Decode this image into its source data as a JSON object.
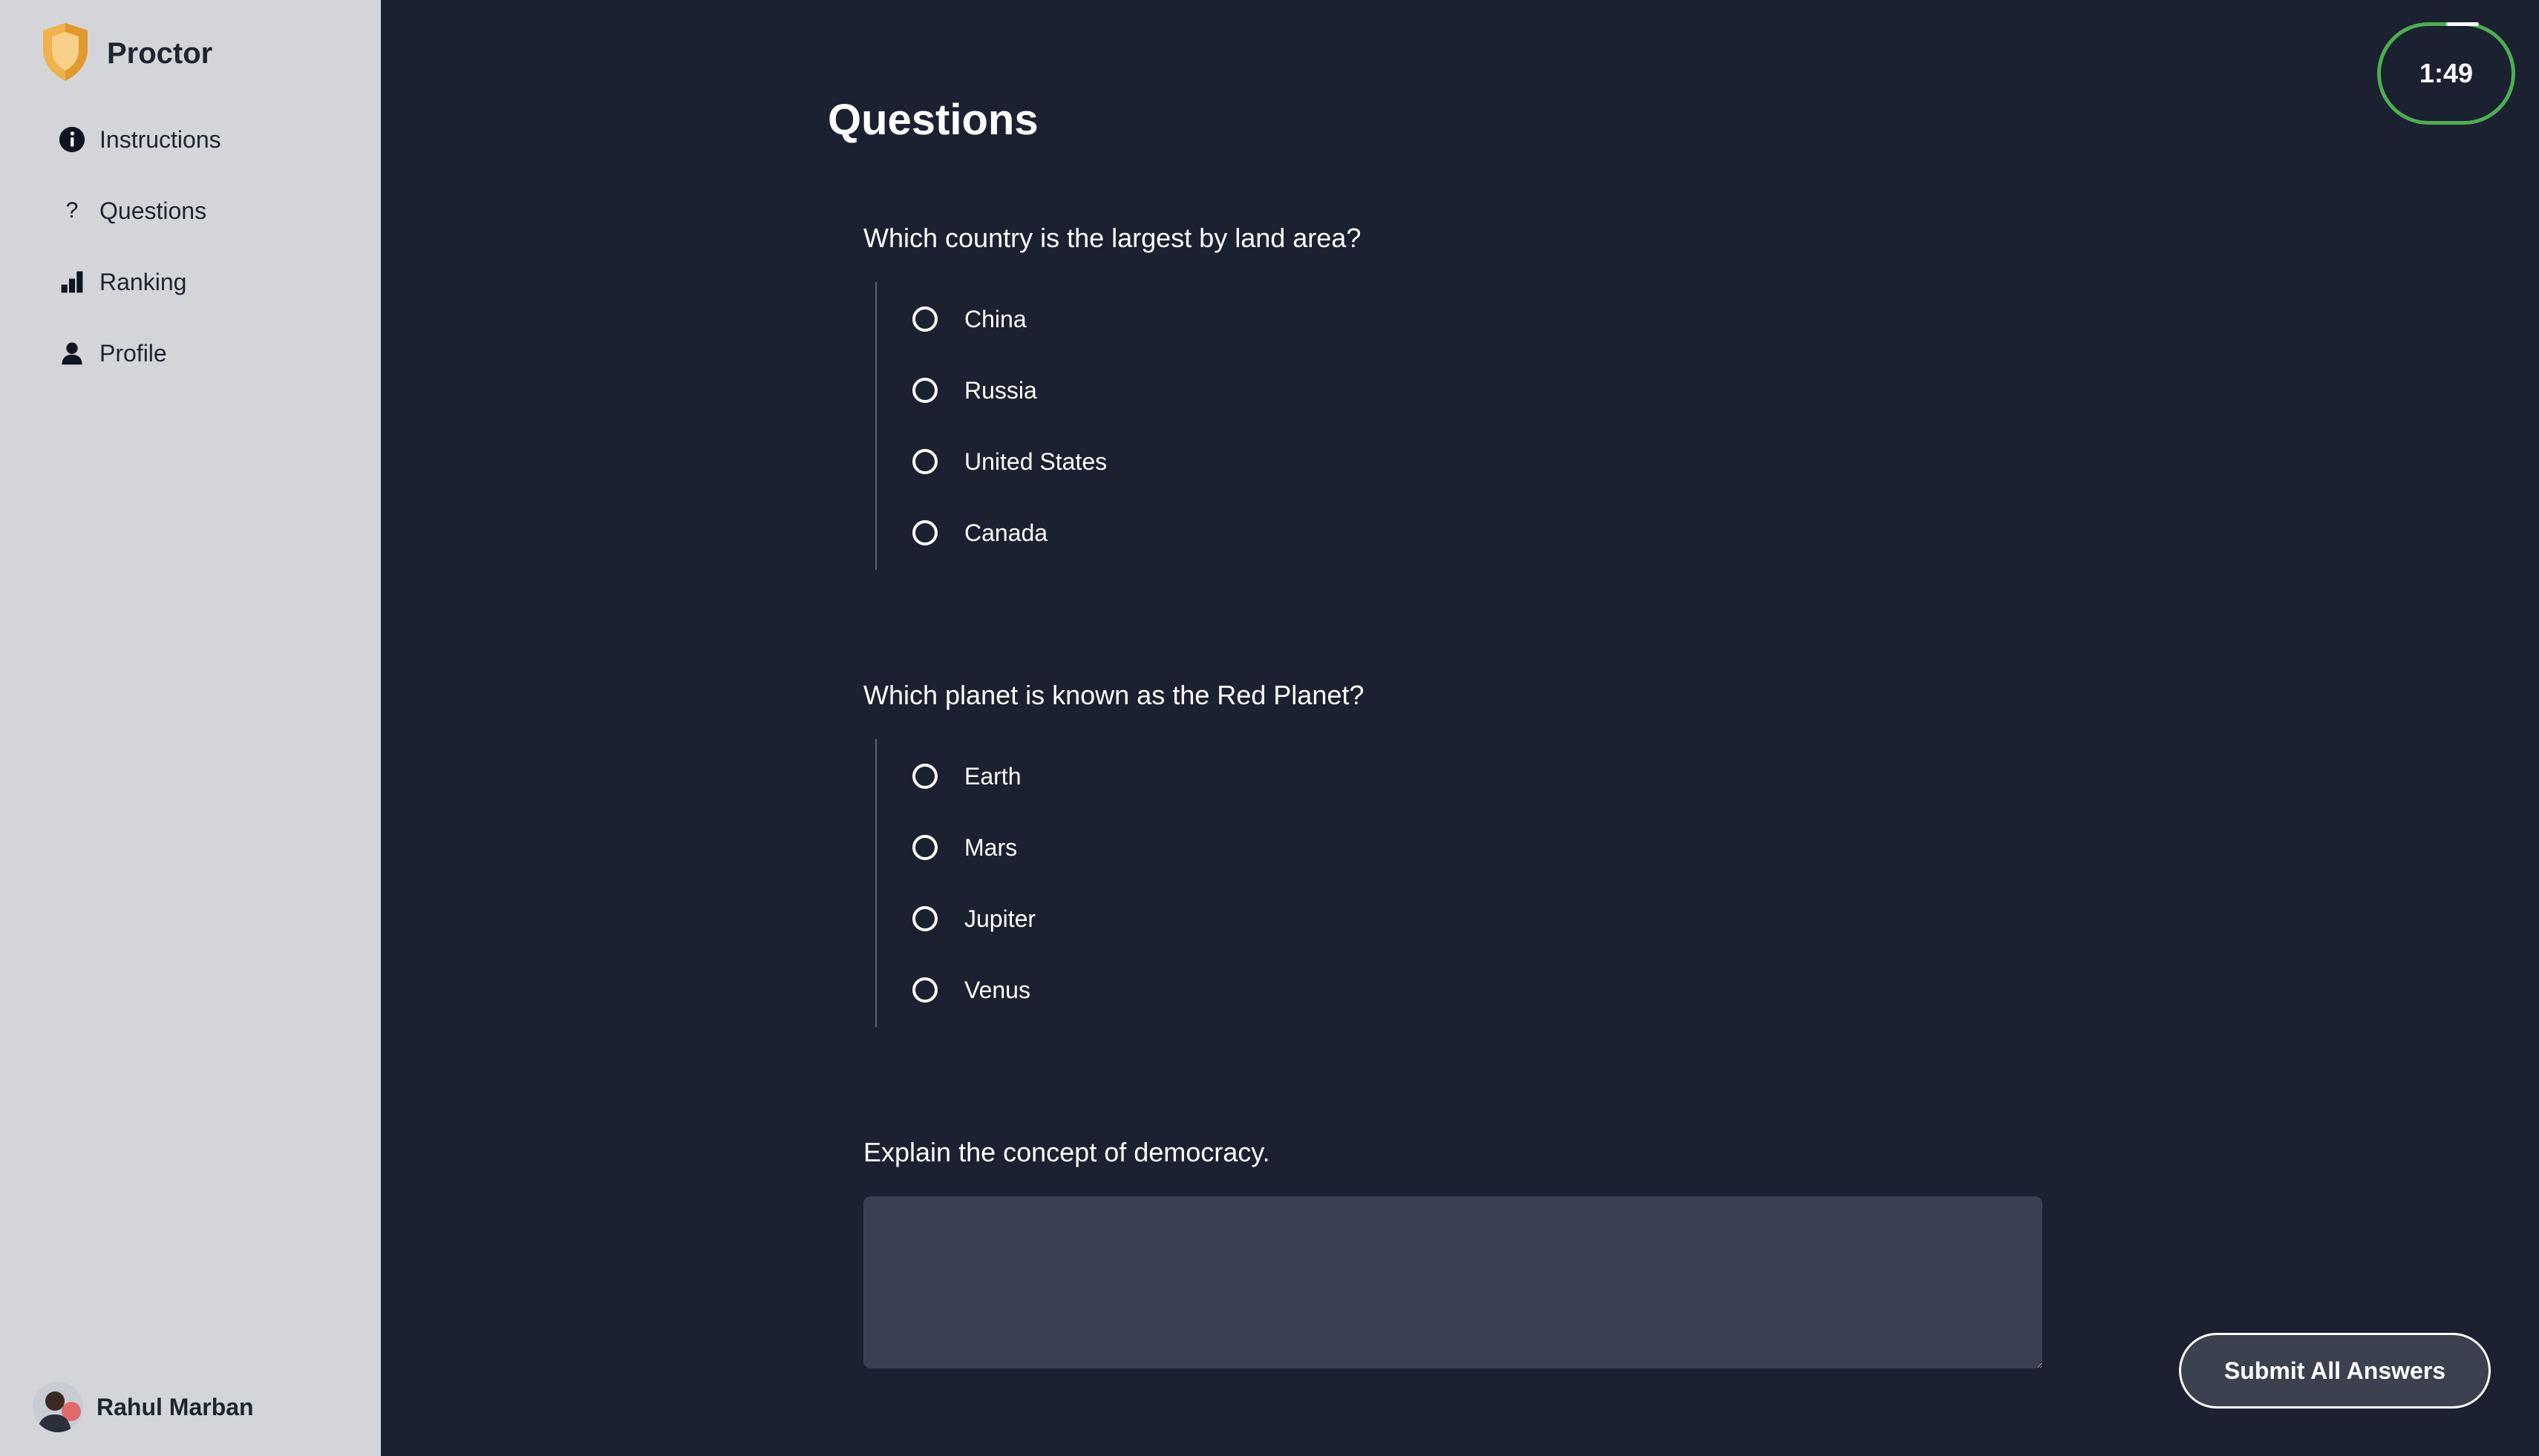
{
  "app": {
    "name": "Proctor"
  },
  "sidebar": {
    "items": [
      {
        "label": "Instructions",
        "icon": "info-icon"
      },
      {
        "label": "Questions",
        "icon": "question-mark-icon"
      },
      {
        "label": "Ranking",
        "icon": "bar-chart-icon"
      },
      {
        "label": "Profile",
        "icon": "person-icon"
      }
    ],
    "user": {
      "name": "Rahul Marban"
    }
  },
  "main": {
    "title": "Questions",
    "questions": [
      {
        "text": "Which country is the largest by land area?",
        "options": [
          "China",
          "Russia",
          "United States",
          "Canada"
        ]
      },
      {
        "text": "Which planet is known as the Red Planet?",
        "options": [
          "Earth",
          "Mars",
          "Jupiter",
          "Venus"
        ]
      },
      {
        "text": "Explain the concept of democracy.",
        "answer_value": "",
        "answer_placeholder": ""
      }
    ],
    "submit_label": "Submit All Answers",
    "timer": "1:49"
  },
  "colors": {
    "background": "#1b2130",
    "sidebar": "#d3d5d9",
    "timer_ring": "#4caf50",
    "textarea": "#3a4051",
    "shield": "#f0b24a"
  }
}
